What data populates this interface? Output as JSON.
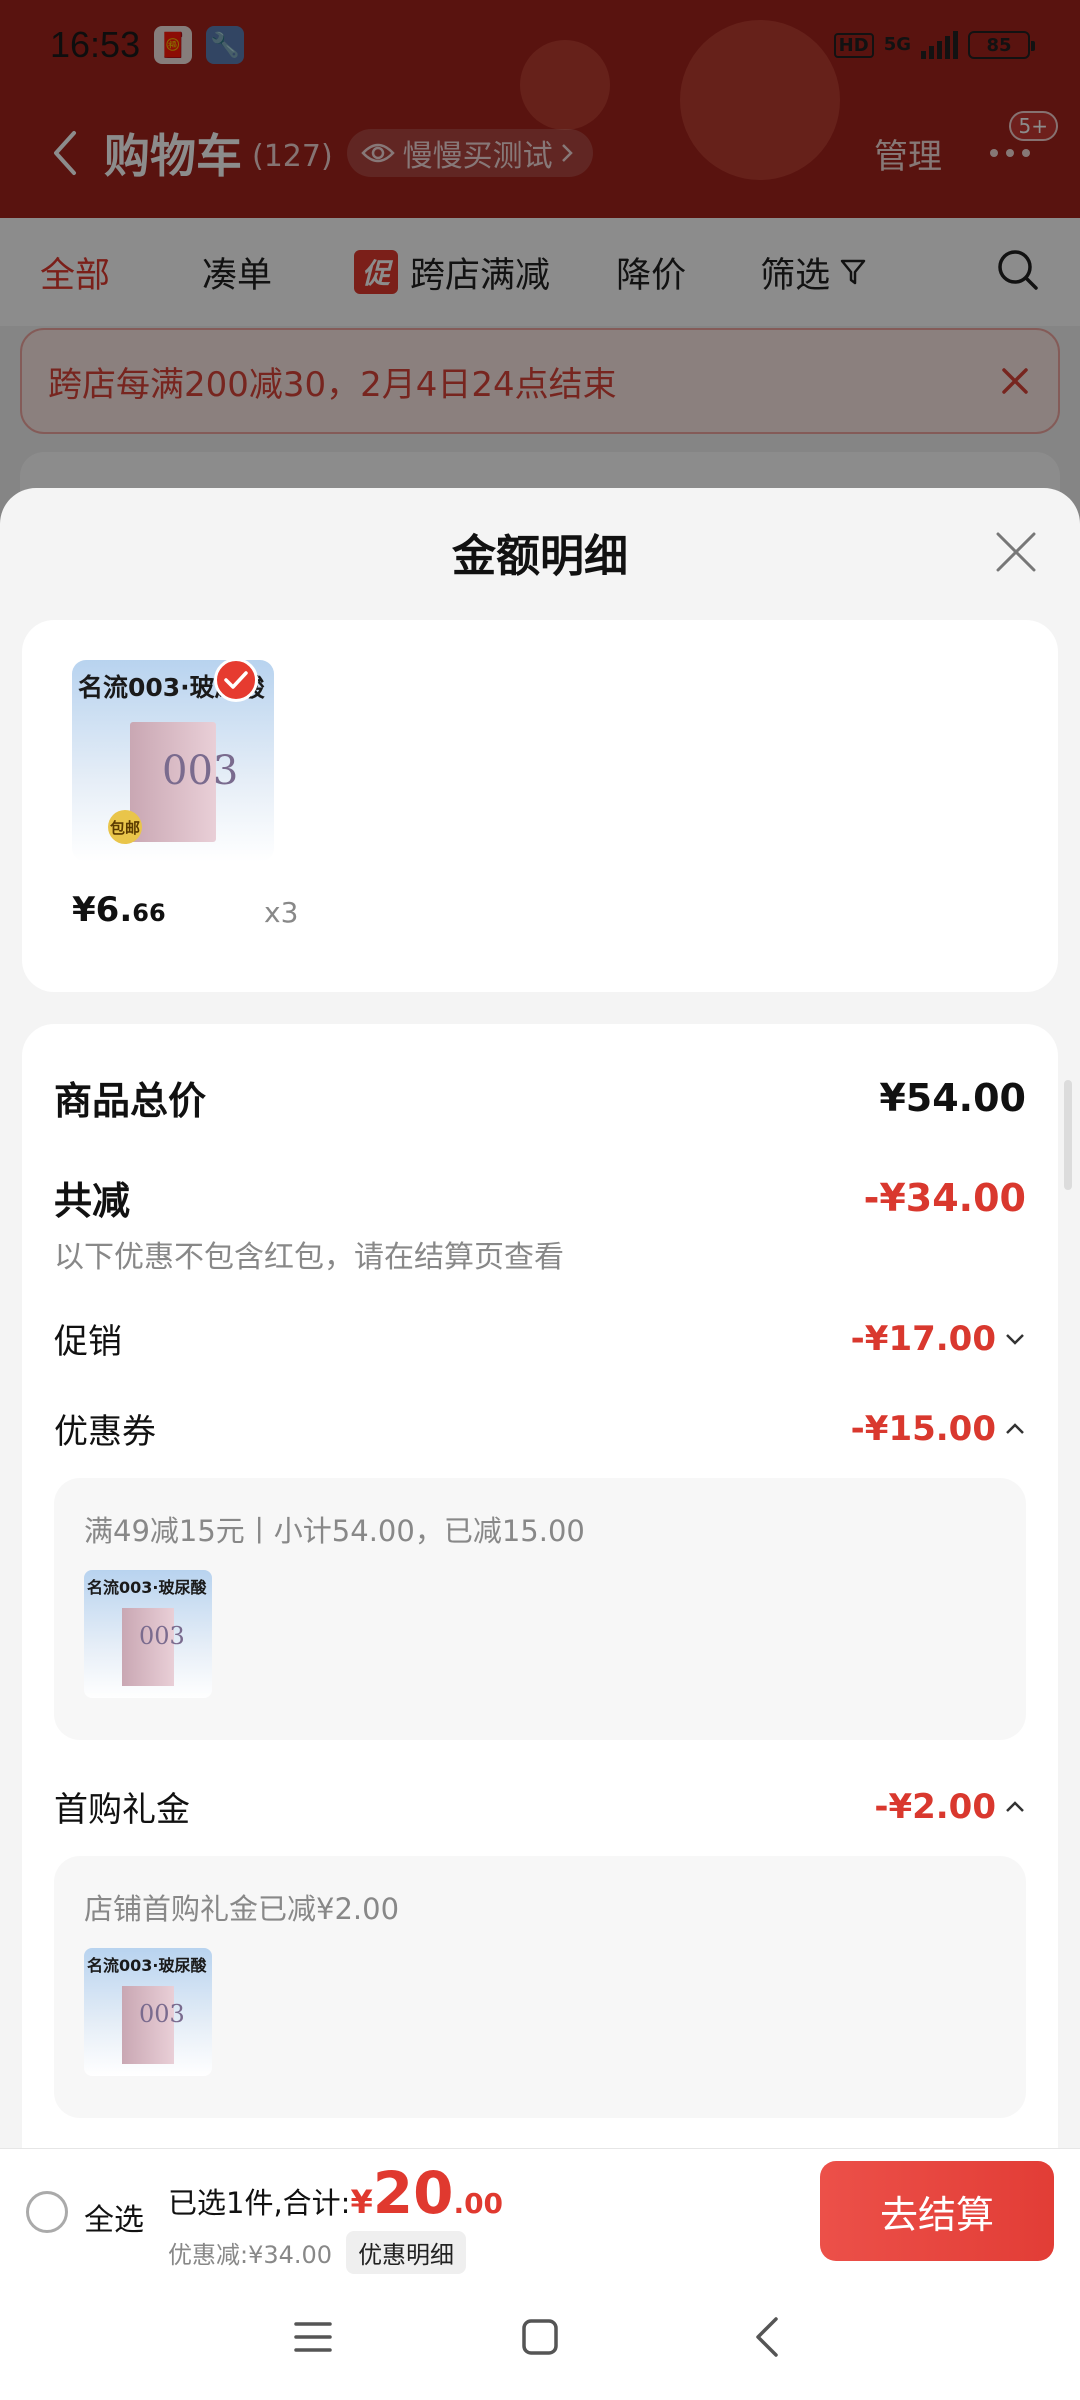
{
  "status": {
    "time": "16:53",
    "hd": "HD",
    "network": "5G",
    "battery": "85"
  },
  "nav": {
    "title": "购物车",
    "count": "(127)",
    "chip_label": "慢慢买测试",
    "manage": "管理",
    "badge": "5+"
  },
  "tabs": [
    {
      "label": "全部",
      "active": true
    },
    {
      "label": "凑单"
    },
    {
      "label": "跨店满减",
      "tag": "促"
    },
    {
      "label": "降价"
    },
    {
      "label": "筛选"
    }
  ],
  "notice": {
    "text": "跨店每满200减30，2月4日24点结束"
  },
  "sheet": {
    "title": "金额明细",
    "product": {
      "thumb_label": "名流003·玻尿酸",
      "thumb_badge": "包邮",
      "thumb_model": "003",
      "price_symbol": "¥",
      "price_int": "6.",
      "price_dec": "66",
      "qty": "x3"
    },
    "rows": {
      "total_label": "商品总价",
      "total_value": "¥54.00",
      "discount_label": "共减",
      "discount_value": "-¥34.00",
      "discount_note": "以下优惠不包含红包，请在结算页查看",
      "promo_label": "促销",
      "promo_value": "-¥17.00",
      "coupon_label": "优惠券",
      "coupon_value": "-¥15.00",
      "coupon_detail": "满49减15元丨小计54.00，已减15.00",
      "gift_label": "首购礼金",
      "gift_value": "-¥2.00",
      "gift_detail": "店铺首购礼金已减¥2.00"
    }
  },
  "bottom": {
    "select_all": "全选",
    "selected_text": "已选1件,合计:",
    "total_symbol": "¥",
    "total_int": "20",
    "total_dec": ".00",
    "discount_text": "优惠减:¥34.00",
    "detail_chip": "优惠明细",
    "checkout": "去结算"
  },
  "colors": {
    "header_red": "#a3231c",
    "accent_red": "#e0392f",
    "checkout_red": "#e23d36"
  }
}
